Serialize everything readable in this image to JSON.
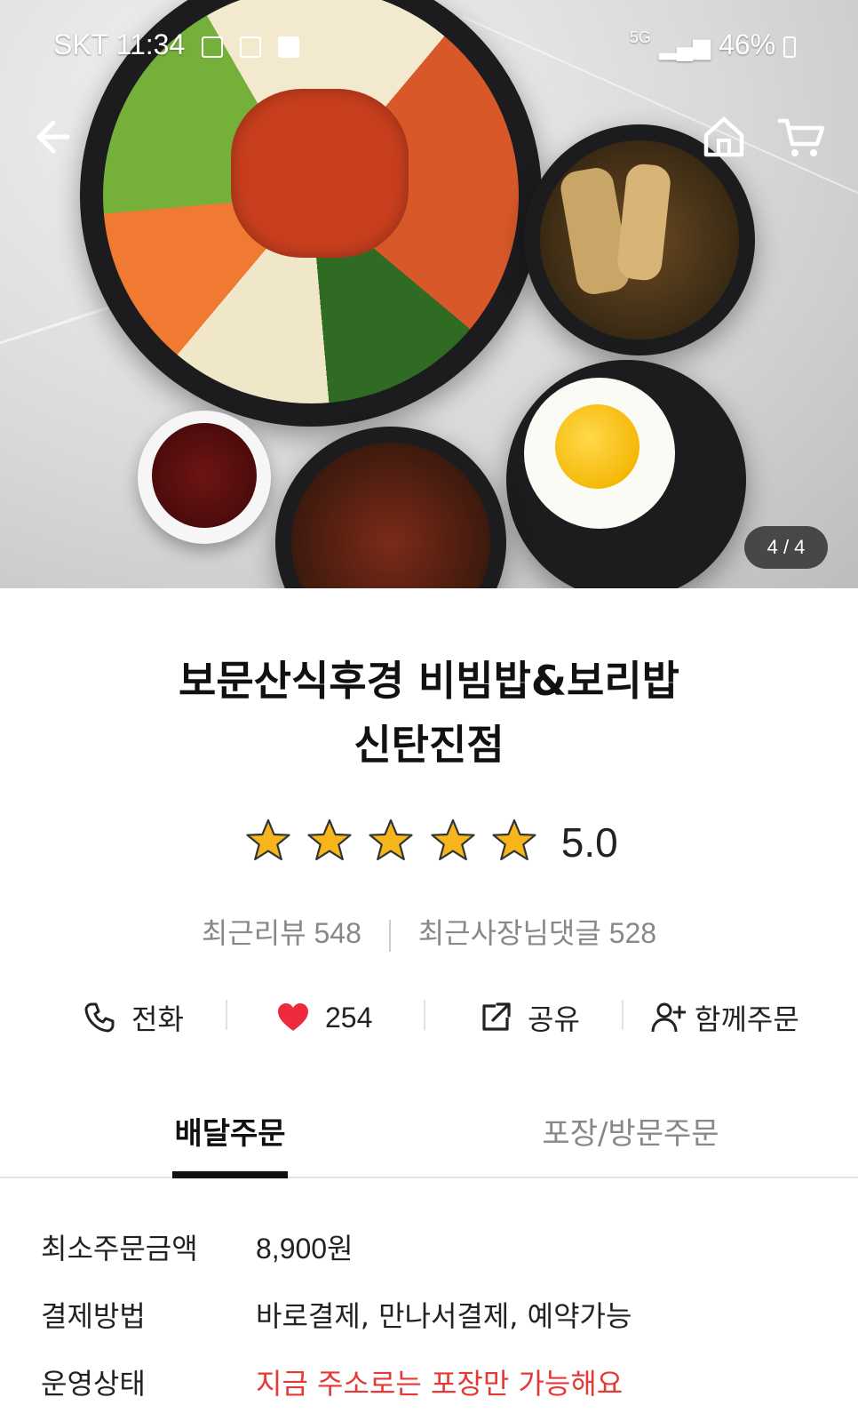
{
  "status_bar": {
    "carrier_time": "SKT 11:34",
    "network": "5G",
    "battery": "46%"
  },
  "hero": {
    "image_counter": "4 / 4"
  },
  "store": {
    "name_line1": "보문산식후경 비빔밥&보리밥",
    "name_line2": "신탄진점",
    "rating_stars": 5,
    "rating": "5.0",
    "recent_reviews": "최근리뷰 548",
    "recent_owner_replies": "최근사장님댓글 528"
  },
  "actions": {
    "call": "전화",
    "likes": "254",
    "share": "공유",
    "group_order": "함께주문"
  },
  "tabs": {
    "delivery": "배달주문",
    "pickup": "포장/방문주문"
  },
  "info": [
    {
      "label": "최소주문금액",
      "value": "8,900원"
    },
    {
      "label": "결제방법",
      "value": "바로결제, 만나서결제, 예약가능"
    },
    {
      "label": "운영상태",
      "value": "지금 주소로는 포장만 가능해요"
    }
  ],
  "colors": {
    "accent_red": "#e53935",
    "star_gold": "#f6b51a",
    "heart_red": "#ee2b3c"
  }
}
